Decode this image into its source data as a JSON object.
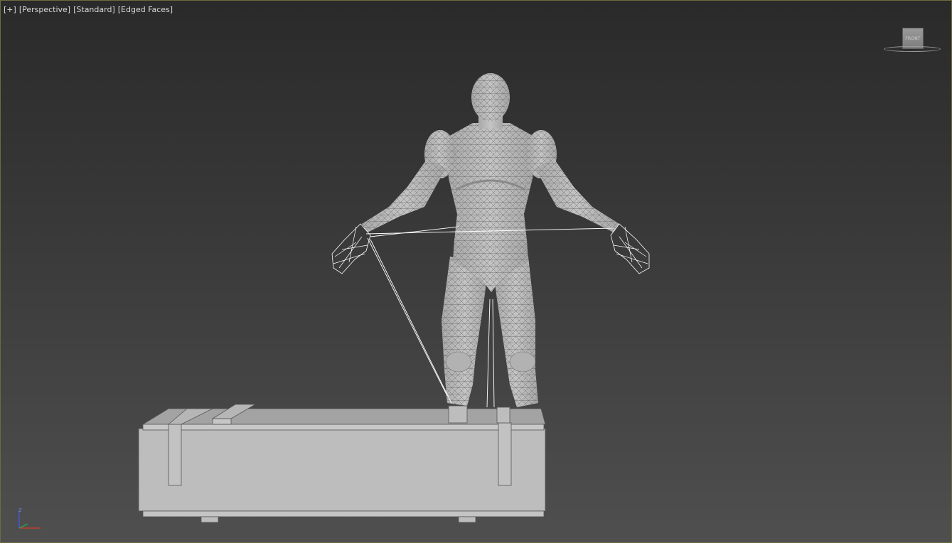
{
  "viewport": {
    "labels": [
      "[+]",
      "[Perspective]",
      "[Standard]",
      "[Edged Faces]"
    ]
  },
  "viewcube": {
    "face_label": "FRONT"
  },
  "axis_gizmo": {
    "z_label": "z"
  },
  "colors": {
    "background_top": "#2a2a2a",
    "background_bottom": "#4f4f4f",
    "mesh_fill": "#bdbdbd",
    "wire": "#5a5a5a",
    "selection_wire": "#ffffff",
    "axis_x": "#d23b2b",
    "axis_y": "#2bb34a",
    "axis_z": "#3a5cff"
  }
}
